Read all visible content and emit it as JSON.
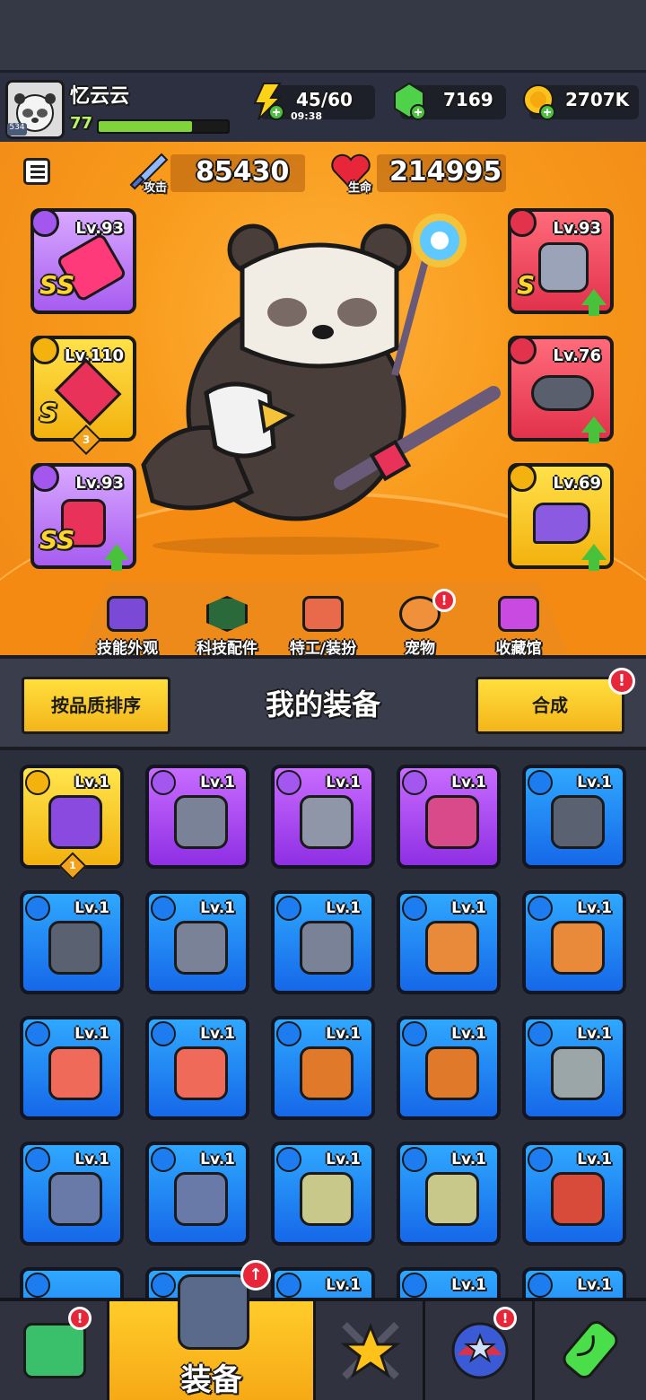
{
  "header": {
    "player_name": "忆云云",
    "player_level": "77",
    "avatar_badge": "534",
    "xp_fraction": 0.72,
    "energy": "45/60",
    "energy_timer": "09:38",
    "gems": "7169",
    "gold": "2707K"
  },
  "hero": {
    "attack_value": "85430",
    "attack_label": "攻击",
    "hp_value": "214995",
    "hp_label": "生命",
    "left_slots": [
      {
        "level": "Lv.93",
        "grade": "SS",
        "type": "weapon"
      },
      {
        "level": "Lv.110",
        "grade": "S",
        "type": "necklace",
        "count": "3"
      },
      {
        "level": "Lv.93",
        "grade": "SS",
        "type": "gloves",
        "upgrade": true
      }
    ],
    "right_slots": [
      {
        "level": "Lv.93",
        "grade": "S",
        "type": "armor",
        "upgrade": true
      },
      {
        "level": "Lv.76",
        "grade": "",
        "type": "belt",
        "upgrade": true
      },
      {
        "level": "Lv.69",
        "grade": "",
        "type": "shoes",
        "upgrade": true
      }
    ],
    "features": [
      {
        "label": "技能外观",
        "icon": "hat-icon"
      },
      {
        "label": "科技配件",
        "icon": "tech-chip-icon"
      },
      {
        "label": "特工/装扮",
        "icon": "agent-icon"
      },
      {
        "label": "宠物",
        "icon": "pet-icon",
        "notify": "!"
      },
      {
        "label": "收藏馆",
        "icon": "collection-chest-icon"
      }
    ]
  },
  "equipment": {
    "sort_button": "按品质排序",
    "title": "我的装备",
    "merge_button": "合成",
    "merge_notify": "!",
    "items": [
      {
        "level": "Lv.1",
        "rarity": "gold",
        "icon": "gauntlet-icon",
        "count": "1"
      },
      {
        "level": "Lv.1",
        "rarity": "purple",
        "icon": "revolver-icon"
      },
      {
        "level": "Lv.1",
        "rarity": "purple",
        "icon": "belt-icon"
      },
      {
        "level": "Lv.1",
        "rarity": "purple",
        "icon": "boots-icon"
      },
      {
        "level": "Lv.1",
        "rarity": "blue",
        "icon": "kunai-icon"
      },
      {
        "level": "Lv.1",
        "rarity": "blue",
        "icon": "kunai-icon"
      },
      {
        "level": "Lv.1",
        "rarity": "blue",
        "icon": "revolver-icon"
      },
      {
        "level": "Lv.1",
        "rarity": "blue",
        "icon": "revolver-icon"
      },
      {
        "level": "Lv.1",
        "rarity": "blue",
        "icon": "bat-icon"
      },
      {
        "level": "Lv.1",
        "rarity": "blue",
        "icon": "bat-icon"
      },
      {
        "level": "Lv.1",
        "rarity": "blue",
        "icon": "vest-icon"
      },
      {
        "level": "Lv.1",
        "rarity": "blue",
        "icon": "vest-icon"
      },
      {
        "level": "Lv.1",
        "rarity": "blue",
        "icon": "jacket-icon"
      },
      {
        "level": "Lv.1",
        "rarity": "blue",
        "icon": "jacket-icon"
      },
      {
        "level": "Lv.1",
        "rarity": "blue",
        "icon": "armor-icon"
      },
      {
        "level": "Lv.1",
        "rarity": "blue",
        "icon": "chestplate-icon"
      },
      {
        "level": "Lv.1",
        "rarity": "blue",
        "icon": "chestplate-icon"
      },
      {
        "level": "Lv.1",
        "rarity": "blue",
        "icon": "shirt-icon"
      },
      {
        "level": "Lv.1",
        "rarity": "blue",
        "icon": "shirt-icon"
      },
      {
        "level": "Lv.1",
        "rarity": "blue",
        "icon": "bone-necklace-icon"
      },
      {
        "level": "",
        "rarity": "blue",
        "icon": "necklace-icon"
      },
      {
        "level": "",
        "rarity": "blue",
        "icon": "necklace-icon"
      },
      {
        "level": "Lv.1",
        "rarity": "blue",
        "icon": "necklace-icon"
      },
      {
        "level": "Lv.1",
        "rarity": "blue",
        "icon": "necklace-icon"
      },
      {
        "level": "Lv.1",
        "rarity": "blue",
        "icon": "belt-icon"
      }
    ]
  },
  "nav": {
    "items": [
      {
        "label": "",
        "icon": "shop-icon",
        "notify": "!"
      },
      {
        "label": "装备",
        "icon": "equipment-icon",
        "active": true,
        "notify": "↑"
      },
      {
        "label": "",
        "icon": "battle-star-icon"
      },
      {
        "label": "",
        "icon": "stars-orb-icon",
        "notify": "!"
      },
      {
        "label": "",
        "icon": "dna-capsule-icon"
      }
    ]
  },
  "colors": {
    "blue": "#1c86f2",
    "purple": "#a94ff0",
    "gold": "#f6c21a",
    "red": "#e9384e",
    "orange_bg": "#f5951a"
  }
}
